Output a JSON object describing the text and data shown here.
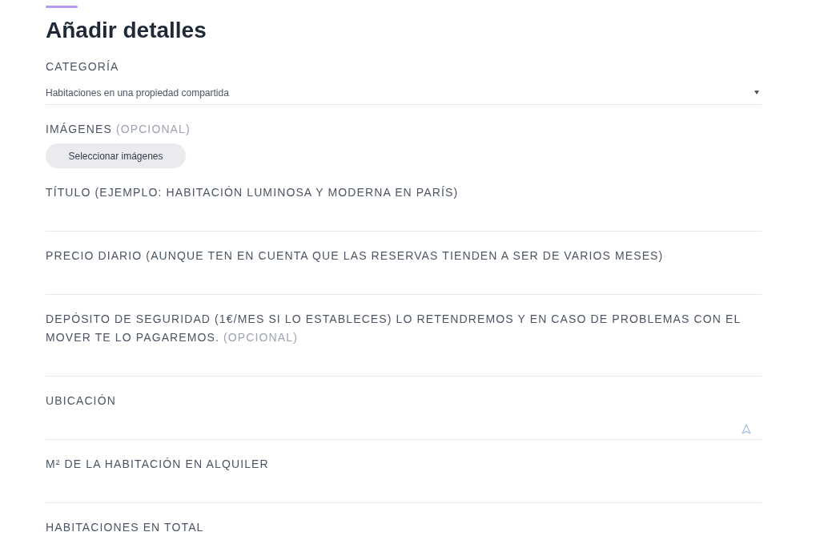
{
  "heading": "Añadir detalles",
  "fields": [
    {
      "kind": "select",
      "label": "CATEGORÍA",
      "value": "Habitaciones en una propiedad compartida"
    },
    {
      "kind": "images",
      "label": "IMÁGENES",
      "optional": "(OPCIONAL)",
      "button": "Seleccionar imágenes"
    },
    {
      "kind": "text",
      "label": "TÍTULO (EJEMPLO: HABITACIÓN LUMINOSA Y MODERNA EN PARÍS)"
    },
    {
      "kind": "text",
      "label": "PRECIO DIARIO (AUNQUE TEN EN CUENTA QUE LAS RESERVAS TIENDEN A SER DE VARIOS MESES)"
    },
    {
      "kind": "text",
      "label": "DEPÓSITO DE SEGURIDAD (1€/MES SI LO ESTABLECES) LO RETENDREMOS Y EN CASO DE PROBLEMAS CON EL MOVER TE LO PAGAREMOS.",
      "optional": "(OPCIONAL)"
    },
    {
      "kind": "location",
      "label": "UBICACIÓN"
    },
    {
      "kind": "text",
      "label": "M² DE LA HABITACIÓN EN ALQUILER"
    },
    {
      "kind": "text",
      "label": "HABITACIONES EN TOTAL"
    }
  ]
}
